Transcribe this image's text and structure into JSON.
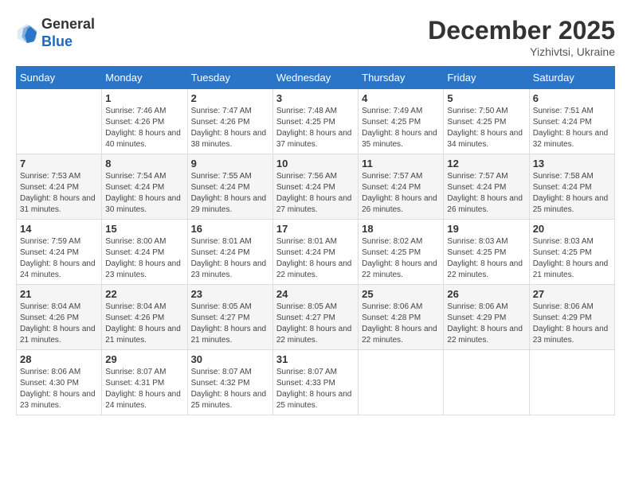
{
  "logo": {
    "general": "General",
    "blue": "Blue"
  },
  "header": {
    "month": "December 2025",
    "location": "Yizhivtsi, Ukraine"
  },
  "weekdays": [
    "Sunday",
    "Monday",
    "Tuesday",
    "Wednesday",
    "Thursday",
    "Friday",
    "Saturday"
  ],
  "weeks": [
    [
      {
        "day": "",
        "sunrise": "",
        "sunset": "",
        "daylight": ""
      },
      {
        "day": "1",
        "sunrise": "Sunrise: 7:46 AM",
        "sunset": "Sunset: 4:26 PM",
        "daylight": "Daylight: 8 hours and 40 minutes."
      },
      {
        "day": "2",
        "sunrise": "Sunrise: 7:47 AM",
        "sunset": "Sunset: 4:26 PM",
        "daylight": "Daylight: 8 hours and 38 minutes."
      },
      {
        "day": "3",
        "sunrise": "Sunrise: 7:48 AM",
        "sunset": "Sunset: 4:25 PM",
        "daylight": "Daylight: 8 hours and 37 minutes."
      },
      {
        "day": "4",
        "sunrise": "Sunrise: 7:49 AM",
        "sunset": "Sunset: 4:25 PM",
        "daylight": "Daylight: 8 hours and 35 minutes."
      },
      {
        "day": "5",
        "sunrise": "Sunrise: 7:50 AM",
        "sunset": "Sunset: 4:25 PM",
        "daylight": "Daylight: 8 hours and 34 minutes."
      },
      {
        "day": "6",
        "sunrise": "Sunrise: 7:51 AM",
        "sunset": "Sunset: 4:24 PM",
        "daylight": "Daylight: 8 hours and 32 minutes."
      }
    ],
    [
      {
        "day": "7",
        "sunrise": "Sunrise: 7:53 AM",
        "sunset": "Sunset: 4:24 PM",
        "daylight": "Daylight: 8 hours and 31 minutes."
      },
      {
        "day": "8",
        "sunrise": "Sunrise: 7:54 AM",
        "sunset": "Sunset: 4:24 PM",
        "daylight": "Daylight: 8 hours and 30 minutes."
      },
      {
        "day": "9",
        "sunrise": "Sunrise: 7:55 AM",
        "sunset": "Sunset: 4:24 PM",
        "daylight": "Daylight: 8 hours and 29 minutes."
      },
      {
        "day": "10",
        "sunrise": "Sunrise: 7:56 AM",
        "sunset": "Sunset: 4:24 PM",
        "daylight": "Daylight: 8 hours and 27 minutes."
      },
      {
        "day": "11",
        "sunrise": "Sunrise: 7:57 AM",
        "sunset": "Sunset: 4:24 PM",
        "daylight": "Daylight: 8 hours and 26 minutes."
      },
      {
        "day": "12",
        "sunrise": "Sunrise: 7:57 AM",
        "sunset": "Sunset: 4:24 PM",
        "daylight": "Daylight: 8 hours and 26 minutes."
      },
      {
        "day": "13",
        "sunrise": "Sunrise: 7:58 AM",
        "sunset": "Sunset: 4:24 PM",
        "daylight": "Daylight: 8 hours and 25 minutes."
      }
    ],
    [
      {
        "day": "14",
        "sunrise": "Sunrise: 7:59 AM",
        "sunset": "Sunset: 4:24 PM",
        "daylight": "Daylight: 8 hours and 24 minutes."
      },
      {
        "day": "15",
        "sunrise": "Sunrise: 8:00 AM",
        "sunset": "Sunset: 4:24 PM",
        "daylight": "Daylight: 8 hours and 23 minutes."
      },
      {
        "day": "16",
        "sunrise": "Sunrise: 8:01 AM",
        "sunset": "Sunset: 4:24 PM",
        "daylight": "Daylight: 8 hours and 23 minutes."
      },
      {
        "day": "17",
        "sunrise": "Sunrise: 8:01 AM",
        "sunset": "Sunset: 4:24 PM",
        "daylight": "Daylight: 8 hours and 22 minutes."
      },
      {
        "day": "18",
        "sunrise": "Sunrise: 8:02 AM",
        "sunset": "Sunset: 4:25 PM",
        "daylight": "Daylight: 8 hours and 22 minutes."
      },
      {
        "day": "19",
        "sunrise": "Sunrise: 8:03 AM",
        "sunset": "Sunset: 4:25 PM",
        "daylight": "Daylight: 8 hours and 22 minutes."
      },
      {
        "day": "20",
        "sunrise": "Sunrise: 8:03 AM",
        "sunset": "Sunset: 4:25 PM",
        "daylight": "Daylight: 8 hours and 21 minutes."
      }
    ],
    [
      {
        "day": "21",
        "sunrise": "Sunrise: 8:04 AM",
        "sunset": "Sunset: 4:26 PM",
        "daylight": "Daylight: 8 hours and 21 minutes."
      },
      {
        "day": "22",
        "sunrise": "Sunrise: 8:04 AM",
        "sunset": "Sunset: 4:26 PM",
        "daylight": "Daylight: 8 hours and 21 minutes."
      },
      {
        "day": "23",
        "sunrise": "Sunrise: 8:05 AM",
        "sunset": "Sunset: 4:27 PM",
        "daylight": "Daylight: 8 hours and 21 minutes."
      },
      {
        "day": "24",
        "sunrise": "Sunrise: 8:05 AM",
        "sunset": "Sunset: 4:27 PM",
        "daylight": "Daylight: 8 hours and 22 minutes."
      },
      {
        "day": "25",
        "sunrise": "Sunrise: 8:06 AM",
        "sunset": "Sunset: 4:28 PM",
        "daylight": "Daylight: 8 hours and 22 minutes."
      },
      {
        "day": "26",
        "sunrise": "Sunrise: 8:06 AM",
        "sunset": "Sunset: 4:29 PM",
        "daylight": "Daylight: 8 hours and 22 minutes."
      },
      {
        "day": "27",
        "sunrise": "Sunrise: 8:06 AM",
        "sunset": "Sunset: 4:29 PM",
        "daylight": "Daylight: 8 hours and 23 minutes."
      }
    ],
    [
      {
        "day": "28",
        "sunrise": "Sunrise: 8:06 AM",
        "sunset": "Sunset: 4:30 PM",
        "daylight": "Daylight: 8 hours and 23 minutes."
      },
      {
        "day": "29",
        "sunrise": "Sunrise: 8:07 AM",
        "sunset": "Sunset: 4:31 PM",
        "daylight": "Daylight: 8 hours and 24 minutes."
      },
      {
        "day": "30",
        "sunrise": "Sunrise: 8:07 AM",
        "sunset": "Sunset: 4:32 PM",
        "daylight": "Daylight: 8 hours and 25 minutes."
      },
      {
        "day": "31",
        "sunrise": "Sunrise: 8:07 AM",
        "sunset": "Sunset: 4:33 PM",
        "daylight": "Daylight: 8 hours and 25 minutes."
      },
      {
        "day": "",
        "sunrise": "",
        "sunset": "",
        "daylight": ""
      },
      {
        "day": "",
        "sunrise": "",
        "sunset": "",
        "daylight": ""
      },
      {
        "day": "",
        "sunrise": "",
        "sunset": "",
        "daylight": ""
      }
    ]
  ]
}
